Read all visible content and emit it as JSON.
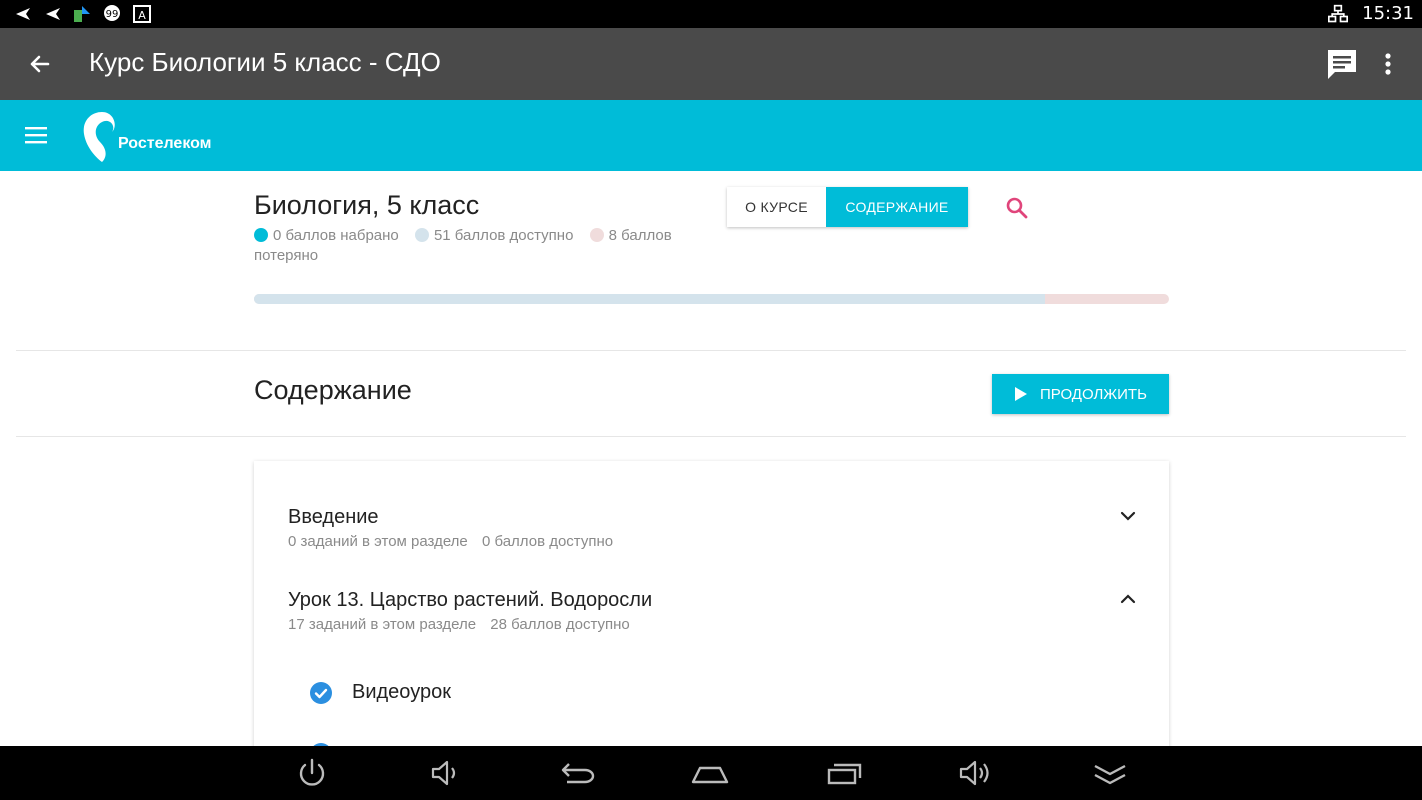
{
  "status_bar": {
    "time": "15:31",
    "icons": [
      "back-arrow-icon",
      "back-arrow-icon",
      "app-icon",
      "chat-bubble-icon",
      "a-icon",
      "network-icon"
    ]
  },
  "app_bar": {
    "title": "Курс Биологии 5 класс - СДО",
    "icons": [
      "back-arrow-icon",
      "message-icon",
      "more-vert-icon"
    ]
  },
  "brand": {
    "name": "Ростелеком",
    "icons": [
      "menu-icon",
      "rostelecom-logo"
    ]
  },
  "course": {
    "title": "Биология, 5 класс",
    "legend": {
      "earned": "0 баллов набрано",
      "available": "51 баллов доступно",
      "lost": "8 баллов потеряно"
    },
    "progress": {
      "earned": 0,
      "available": 51,
      "lost": 8
    },
    "colors": {
      "earned": "#00bcd8",
      "available": "#d4e3ec",
      "lost": "#f0dcdc",
      "accent": "#00bcd8",
      "search": "#e0457b"
    }
  },
  "tabs": [
    {
      "label": "О КУРСЕ",
      "active": false
    },
    {
      "label": "СОДЕРЖАНИЕ",
      "active": true
    }
  ],
  "content": {
    "title": "Содержание",
    "continue_label": "ПРОДОЛЖИТЬ",
    "sections": [
      {
        "name": "Введение",
        "tasks": "0 заданий в этом разделе",
        "points": "0 баллов доступно",
        "expanded": false
      },
      {
        "name": "Урок 13. Царство растений. Водоросли",
        "tasks": "17 заданий в этом разделе",
        "points": "28 баллов доступно",
        "expanded": true
      }
    ],
    "lessons": [
      {
        "name": "Видеоурок",
        "done": true
      }
    ]
  },
  "nav_bar": {
    "icons": [
      "power-icon",
      "volume-down-icon",
      "back-icon",
      "home-icon",
      "recent-apps-icon",
      "volume-up-icon",
      "collapse-icon"
    ]
  }
}
